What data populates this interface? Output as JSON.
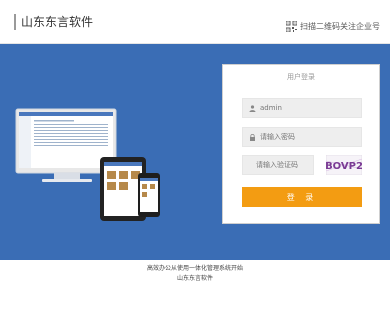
{
  "header": {
    "brand": "山东东言软件",
    "qr_text": "扫描二维码关注企业号"
  },
  "login": {
    "title": "用户登录",
    "username_value": "admin",
    "password_placeholder": "请输入密码",
    "captcha_placeholder": "请输入验证码",
    "captcha_code": "BOVP2",
    "submit_label": "登 录"
  },
  "footer": {
    "line1": "高效办公从使用一体化管理系统开始",
    "line2": "山东东言软件"
  },
  "colors": {
    "banner": "#3a6db5",
    "button": "#f39c12"
  },
  "icons": [
    "qr-code-icon",
    "user-icon",
    "lock-icon"
  ]
}
